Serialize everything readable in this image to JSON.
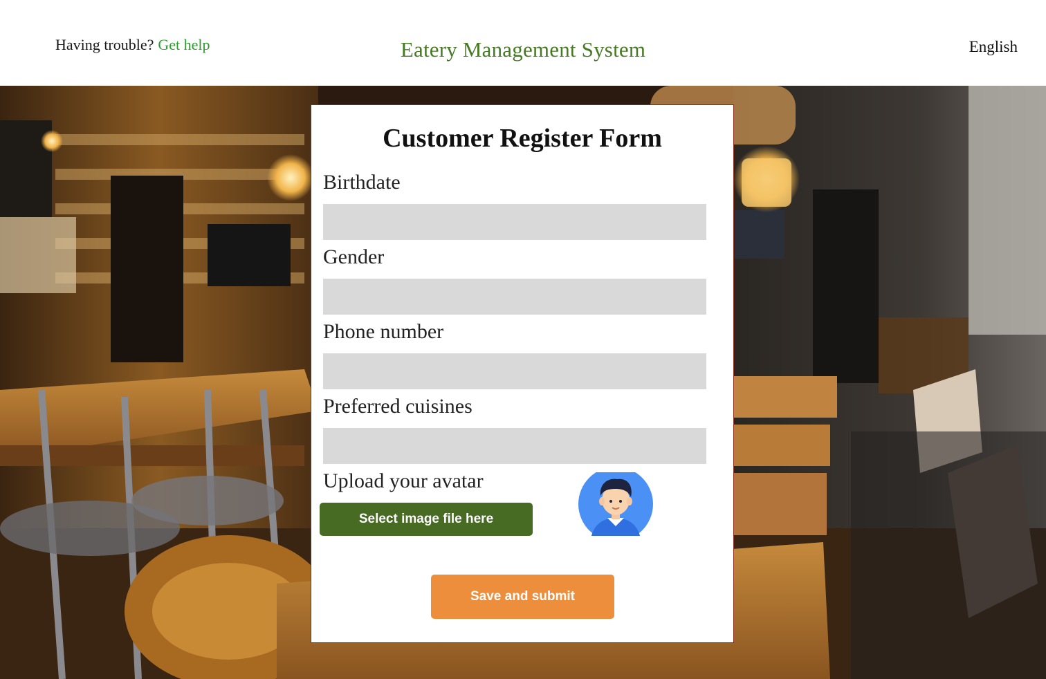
{
  "header": {
    "help_prompt": "Having trouble?",
    "help_link": "Get help",
    "app_title": "Eatery Management System",
    "language": "English"
  },
  "form": {
    "title": "Customer Register Form",
    "fields": [
      {
        "label": "Birthdate",
        "value": ""
      },
      {
        "label": "Gender",
        "value": ""
      },
      {
        "label": "Phone number",
        "value": ""
      },
      {
        "label": "Preferred cuisines",
        "value": ""
      }
    ],
    "avatar_label": "Upload your avatar",
    "select_button": "Select image file here",
    "submit_button": "Save  and submit"
  },
  "icons": {
    "avatar": "person-avatar-icon"
  },
  "colors": {
    "brand_green": "#477a24",
    "help_link": "#2f9a2f",
    "select_button": "#476b22",
    "submit_button": "#ec8e3b",
    "input_bg": "#d9d9d9"
  }
}
